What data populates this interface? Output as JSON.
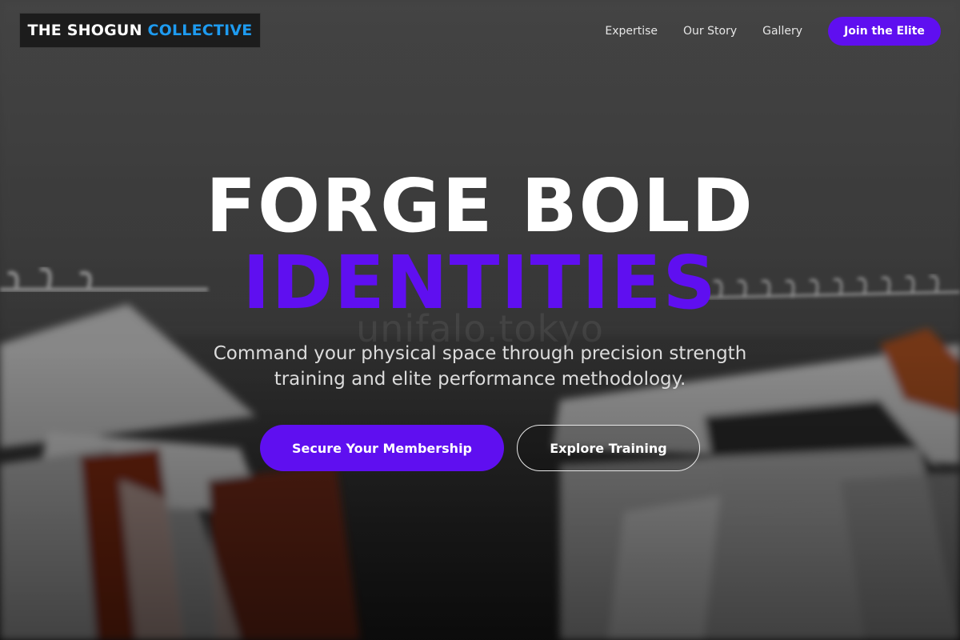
{
  "header": {
    "logo": {
      "part1": "THE SHOGUN",
      "part2": "COLLECTIVE"
    },
    "nav": [
      {
        "label": "Expertise"
      },
      {
        "label": "Our Story"
      },
      {
        "label": "Gallery"
      }
    ],
    "cta_label": "Join the Elite"
  },
  "hero": {
    "headline_line1": "FORGE BOLD",
    "headline_line2": "IDENTITIES",
    "background_watermark": "unifalo.tokyo",
    "subtitle": "Command your physical space through precision strength training and elite performance methodology.",
    "primary_button": "Secure Your Membership",
    "secondary_button": "Explore Training",
    "background_image": "clothing-rack-icon"
  },
  "colors": {
    "accent": "#5f0ff0",
    "logo_highlight": "#1e9bf0",
    "text": "#ffffff"
  }
}
